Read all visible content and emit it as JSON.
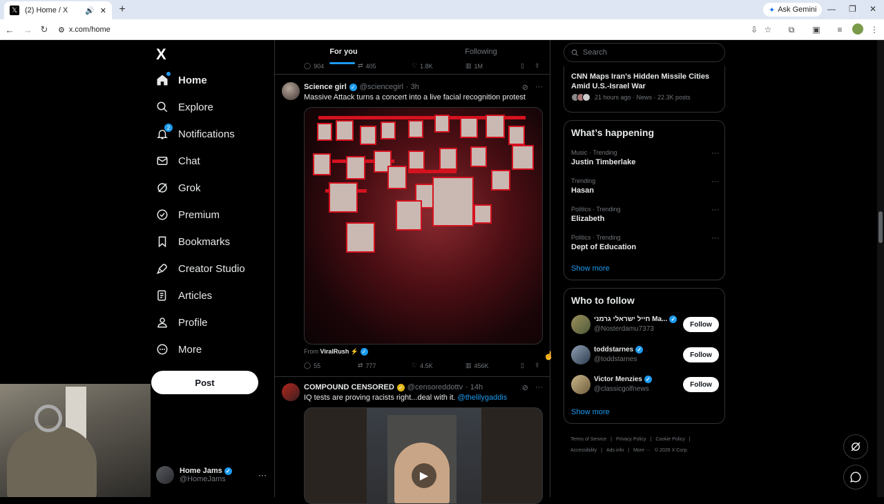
{
  "browser": {
    "tab_title": "(2) Home / X",
    "url": "x.com/home",
    "ask_gemini": "Ask Gemini"
  },
  "sidebar": {
    "logo": "X",
    "items": [
      {
        "label": "Home",
        "icon": "home-icon"
      },
      {
        "label": "Explore",
        "icon": "search-icon"
      },
      {
        "label": "Notifications",
        "icon": "bell-icon",
        "badge": "2"
      },
      {
        "label": "Chat",
        "icon": "mail-icon"
      },
      {
        "label": "Grok",
        "icon": "grok-icon"
      },
      {
        "label": "Premium",
        "icon": "verified-icon"
      },
      {
        "label": "Bookmarks",
        "icon": "bookmark-icon"
      },
      {
        "label": "Creator Studio",
        "icon": "rocket-icon"
      },
      {
        "label": "Articles",
        "icon": "article-icon"
      },
      {
        "label": "Profile",
        "icon": "person-icon"
      },
      {
        "label": "More",
        "icon": "more-circle-icon"
      }
    ],
    "post_button": "Post",
    "account": {
      "name": "Home Jams",
      "handle": "@HomeJams"
    }
  },
  "timeline": {
    "tabs": [
      "For you",
      "Following"
    ],
    "prev_actions": {
      "replies": "904",
      "reposts": "405",
      "likes": "1.8K",
      "views": "1M"
    },
    "tweets": [
      {
        "name": "Science girl",
        "handle": "@sciencegirl",
        "time": "· 3h",
        "text": "Massive Attack turns a concert into a live facial recognition protest",
        "from_label": "From",
        "from_name": "ViralRush ⚡",
        "replies": "55",
        "reposts": "777",
        "likes": "4.5K",
        "views": "456K"
      },
      {
        "name": "COMPOUND CENSORED",
        "handle": "@censoreddottv",
        "time": "· 14h",
        "text": "IQ tests are proving racists right...deal with it.",
        "mention": "@thelilygaddis"
      }
    ]
  },
  "right": {
    "search_placeholder": "Search",
    "news": {
      "title": "CNN Maps Iran's Hidden Missile Cities Amid U.S.-Israel War",
      "meta": "21 hours ago · News · 22.3K posts"
    },
    "whats_happening": {
      "heading": "What’s happening",
      "trends": [
        {
          "meta": "Music · Trending",
          "name": "Justin Timberlake"
        },
        {
          "meta": "Trending",
          "name": "Hasan"
        },
        {
          "meta": "Politics · Trending",
          "name": "Elizabeth"
        },
        {
          "meta": "Politics · Trending",
          "name": "Dept of Education"
        }
      ],
      "show_more": "Show more"
    },
    "who_to_follow": {
      "heading": "Who to follow",
      "accounts": [
        {
          "name": "חייל ישראלי גרמני Ma...",
          "handle": "@Nosterdamu7373",
          "button": "Follow"
        },
        {
          "name": "toddstarnes",
          "handle": "@toddstarnes",
          "button": "Follow"
        },
        {
          "name": "Victor Menzies",
          "handle": "@classicgolfnews",
          "button": "Follow"
        }
      ],
      "show_more": "Show more"
    },
    "footer": {
      "links": [
        "Terms of Service",
        "|",
        "Privacy Policy",
        "|",
        "Cookie Policy",
        "|",
        "Accessibility",
        "|",
        "Ads info",
        "|",
        "More ···",
        "© 2026 X Corp."
      ]
    }
  },
  "colors": {
    "accent": "#1d9bf0",
    "background": "#000000",
    "border": "#2f3336",
    "muted": "#71767b",
    "alert_red": "#d5121f"
  }
}
